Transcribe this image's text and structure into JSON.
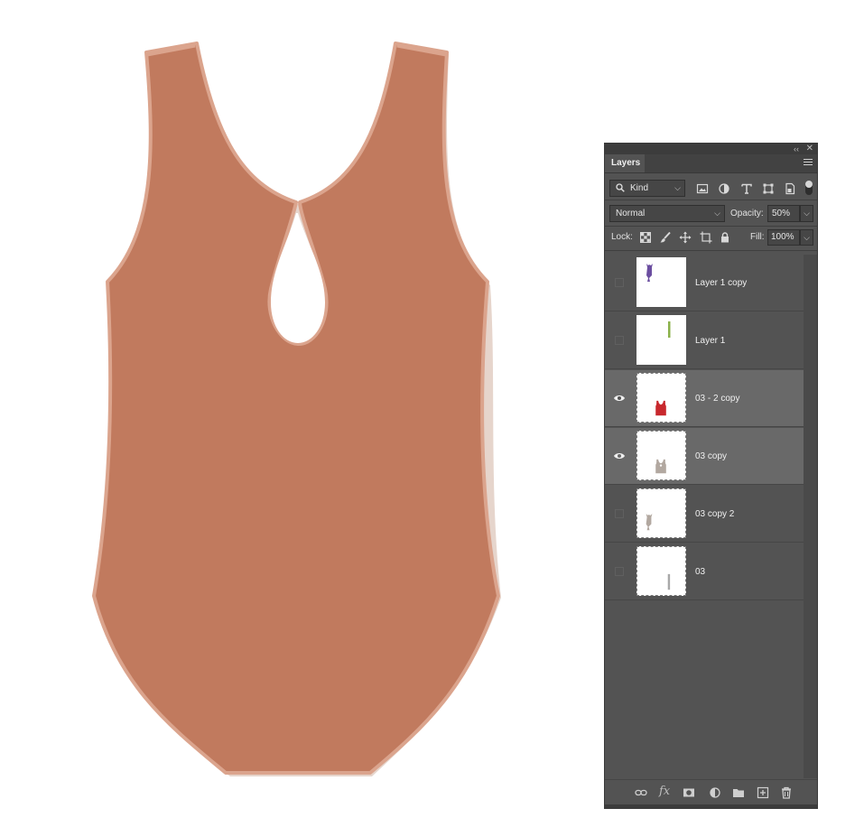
{
  "panel": {
    "tab_label": "Layers",
    "collapse_glyph": "‹‹",
    "close_glyph": "✕"
  },
  "filter": {
    "kind_label": "Kind",
    "icons": [
      "image-filter-icon",
      "adjustment-filter-icon",
      "type-filter-icon",
      "shape-filter-icon",
      "smart-object-filter-icon"
    ]
  },
  "blend": {
    "mode": "Normal",
    "opacity_label": "Opacity:",
    "opacity_value": "50%"
  },
  "lock": {
    "label": "Lock:",
    "icons": [
      "lock-transparent-pixels-icon",
      "lock-image-pixels-icon",
      "lock-position-icon",
      "lock-artboard-icon",
      "lock-all-icon"
    ],
    "fill_label": "Fill:",
    "fill_value": "100%"
  },
  "layers": [
    {
      "name": "Layer 1 copy",
      "visible": false,
      "selected": false,
      "thumb_color": "#6b4ea0",
      "thumb": "figure-purple"
    },
    {
      "name": "Layer 1",
      "visible": false,
      "selected": false,
      "thumb_color": "#8bb14a",
      "thumb": "bar-green"
    },
    {
      "name": "03 - 2 copy",
      "visible": true,
      "selected": true,
      "thumb_color": "#c8282d",
      "thumb": "bodysuit-red"
    },
    {
      "name": "03 copy",
      "visible": true,
      "selected": true,
      "thumb_color": "#b2a8a0",
      "thumb": "bodysuit-gray"
    },
    {
      "name": "03 copy 2",
      "visible": false,
      "selected": false,
      "thumb_color": "#b2a8a0",
      "thumb": "figure-gray"
    },
    {
      "name": "03",
      "visible": false,
      "selected": false,
      "thumb_color": "#a8a8a8",
      "thumb": "bar-gray"
    }
  ],
  "footer": {
    "fx_label": "fx",
    "icons": [
      "link-layers-icon",
      "layer-style-icon",
      "add-mask-icon",
      "adjustment-layer-icon",
      "new-group-icon",
      "new-layer-icon",
      "delete-layer-icon"
    ]
  },
  "canvas": {
    "garment_color": "#c17a5e",
    "garment_edge_color": "#dba48d",
    "shadow_color": "#e6d5cc",
    "subject": "bodysuit-back-view"
  }
}
